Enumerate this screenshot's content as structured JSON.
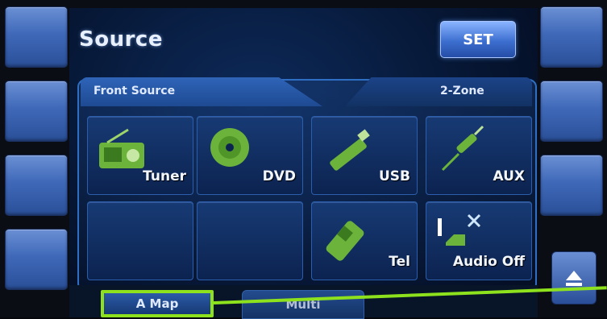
{
  "screen": {
    "title": "Source",
    "set_label": "SET"
  },
  "tabs": {
    "front_label": "Front Source",
    "zone_label": "2-Zone"
  },
  "sources": [
    {
      "label": "Tuner",
      "icon": "radio-icon"
    },
    {
      "label": "DVD",
      "icon": "disc-icon"
    },
    {
      "label": "USB",
      "icon": "usb-icon"
    },
    {
      "label": "AUX",
      "icon": "aux-plug-icon"
    },
    {
      "label": "",
      "icon": ""
    },
    {
      "label": "",
      "icon": ""
    },
    {
      "label": "Tel",
      "icon": "phone-icon"
    },
    {
      "label": "Audio Off",
      "icon": "audio-off-icon"
    }
  ],
  "bottom_tabs": {
    "a_map": "A Map",
    "multi": "Multi"
  },
  "colors": {
    "accent_blue": "#3d6fd0",
    "highlight_green": "#8de21d",
    "icon_green": "#6bb33a"
  }
}
